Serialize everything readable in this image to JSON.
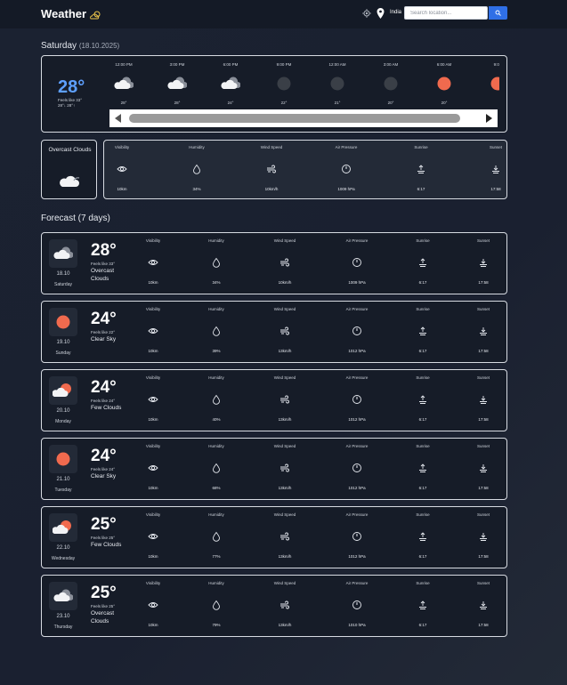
{
  "header": {
    "title": "Weather",
    "location": "India",
    "search_placeholder": "Search location..."
  },
  "today": {
    "day": "Saturday",
    "date": "(18.10.2025)",
    "temp": "28°",
    "feels_line1": "Feels like 33°",
    "feels_line2": "28°↓ 28°↑",
    "condition": "Overcast Clouds",
    "hourly": [
      {
        "time": "12:00 PM",
        "temp": "28°",
        "icon": "cloud-dark-icon"
      },
      {
        "time": "3:00 PM",
        "temp": "28°",
        "icon": "cloud-dark-icon"
      },
      {
        "time": "6:00 PM",
        "temp": "24°",
        "icon": "cloud-dark-icon"
      },
      {
        "time": "9:00 PM",
        "temp": "22°",
        "icon": "moon-icon"
      },
      {
        "time": "12:00 AM",
        "temp": "21°",
        "icon": "moon-icon"
      },
      {
        "time": "3:00 AM",
        "temp": "20°",
        "icon": "moon-icon"
      },
      {
        "time": "6:00 AM",
        "temp": "20°",
        "icon": "sun-icon"
      },
      {
        "time": "9:00",
        "temp": "",
        "icon": "sun-icon"
      }
    ],
    "metrics": [
      {
        "label": "Visibility",
        "value": "10km",
        "icon": "eye-icon"
      },
      {
        "label": "Humidity",
        "value": "34%",
        "icon": "droplet-icon"
      },
      {
        "label": "Wind Speed",
        "value": "10km/h",
        "icon": "wind-icon"
      },
      {
        "label": "Air Pressure",
        "value": "1009 hPa",
        "icon": "gauge-icon"
      },
      {
        "label": "Sunrise",
        "value": "6:17",
        "icon": "sunrise-icon"
      },
      {
        "label": "Sunset",
        "value": "17:58",
        "icon": "sunset-icon"
      }
    ]
  },
  "forecast_title": "Forecast (7 days)",
  "forecast": [
    {
      "date": "18.10",
      "day": "Saturday",
      "temp": "28°",
      "feels": "Feels like 33°",
      "condition": "Overcast Clouds",
      "icon": "cloud-dark-icon",
      "metrics": [
        "10km",
        "34%",
        "10km/h",
        "1009 hPa",
        "6:17",
        "17:58"
      ]
    },
    {
      "date": "19.10",
      "day": "Sunday",
      "temp": "24°",
      "feels": "Feels like 22°",
      "condition": "Clear Sky",
      "icon": "sun-icon",
      "metrics": [
        "10km",
        "39%",
        "13km/h",
        "1012 hPa",
        "6:17",
        "17:58"
      ]
    },
    {
      "date": "20.10",
      "day": "Monday",
      "temp": "24°",
      "feels": "Feels like 24°",
      "condition": "Few Clouds",
      "icon": "sun-cloud-icon",
      "metrics": [
        "10km",
        "40%",
        "13km/h",
        "1012 hPa",
        "6:17",
        "17:58"
      ]
    },
    {
      "date": "21.10",
      "day": "Tuesday",
      "temp": "24°",
      "feels": "Feels like 24°",
      "condition": "Clear Sky",
      "icon": "sun-icon",
      "metrics": [
        "10km",
        "68%",
        "13km/h",
        "1012 hPa",
        "6:17",
        "17:58"
      ]
    },
    {
      "date": "22.10",
      "day": "Wednesday",
      "temp": "25°",
      "feels": "Feels like 25°",
      "condition": "Few Clouds",
      "icon": "sun-cloud-icon",
      "metrics": [
        "10km",
        "77%",
        "13km/h",
        "1012 hPa",
        "6:17",
        "17:58"
      ]
    },
    {
      "date": "23.10",
      "day": "Thursday",
      "temp": "25°",
      "feels": "Feels like 25°",
      "condition": "Overcast Clouds",
      "icon": "cloud-dark-icon",
      "metrics": [
        "10km",
        "79%",
        "13km/h",
        "1010 hPa",
        "6:17",
        "17:58"
      ]
    }
  ],
  "forecast_labels": [
    "Visibility",
    "Humidity",
    "Wind Speed",
    "Air Pressure",
    "Sunrise",
    "Sunset"
  ],
  "colors": {
    "accent": "#2f6fe6",
    "today_temp": "#5ea0ff",
    "sun": "#f06a4e"
  }
}
